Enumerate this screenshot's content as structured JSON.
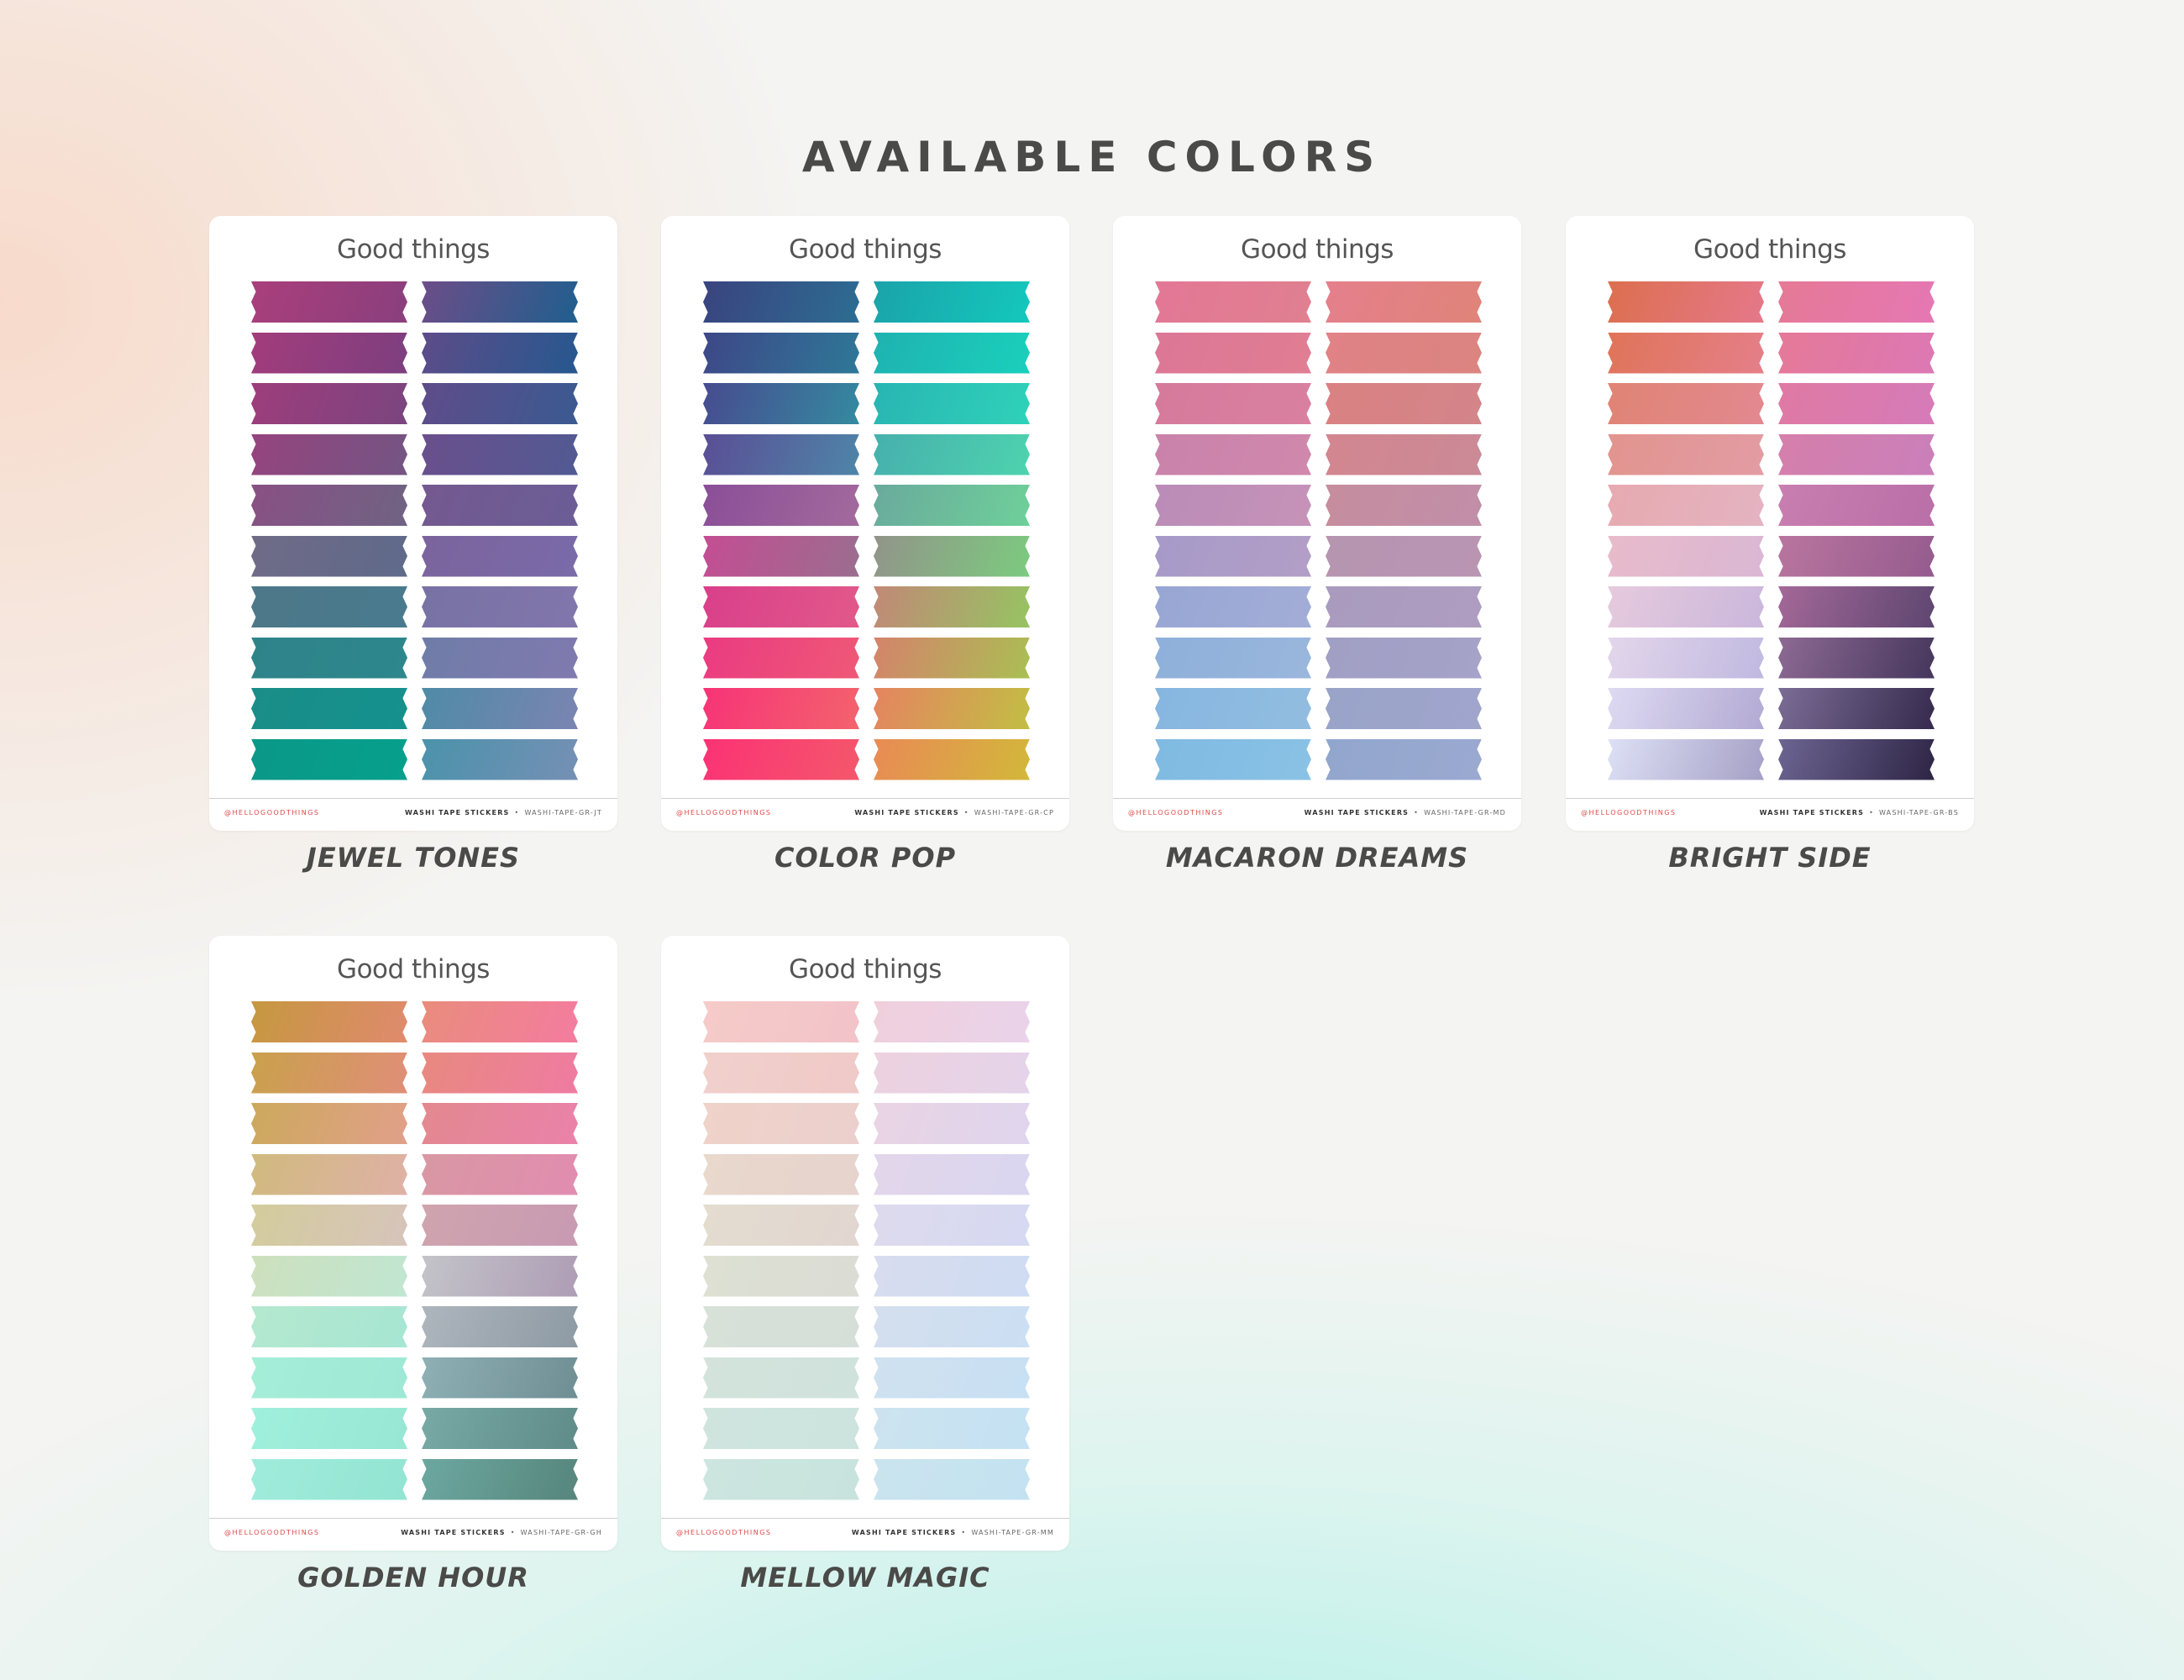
{
  "title": "AVAILABLE COLORS",
  "sheets": [
    {
      "brand": "Good things",
      "handle": "@HELLOGOODTHINGS",
      "product": "WASHI TAPE STICKERS",
      "sku": "WASHI-TAPE-GR-JT",
      "caption": "JEWEL TONES",
      "left": [
        [
          "#a93f7c",
          "#8a3f7d"
        ],
        [
          "#a33c7c",
          "#7c3f7f"
        ],
        [
          "#9e3d7c",
          "#7a457f"
        ],
        [
          "#96447f",
          "#735583"
        ],
        [
          "#895084",
          "#6f6383"
        ],
        [
          "#6f6b87",
          "#5f6a8a"
        ],
        [
          "#4c7889",
          "#4a7a8e"
        ],
        [
          "#2e8389",
          "#2d878c"
        ],
        [
          "#1a8d88",
          "#15918d"
        ],
        [
          "#0b9888",
          "#06a08d"
        ]
      ],
      "right": [
        [
          "#6c4d88",
          "#1f5f8e"
        ],
        [
          "#5d4c89",
          "#26588f"
        ],
        [
          "#5f4c8a",
          "#3a5a91"
        ],
        [
          "#6a4f8c",
          "#515a93"
        ],
        [
          "#745990",
          "#6b5d96"
        ],
        [
          "#7b649d",
          "#7a6aa9"
        ],
        [
          "#7872a4",
          "#8176ac"
        ],
        [
          "#6f7ca8",
          "#807aaf"
        ],
        [
          "#4f8ba6",
          "#7b84b2"
        ],
        [
          "#4b92aa",
          "#7590b5"
        ]
      ]
    },
    {
      "brand": "Good things",
      "handle": "@HELLOGOODTHINGS",
      "product": "WASHI TAPE STICKERS",
      "sku": "WASHI-TAPE-GR-CP",
      "caption": "COLOR POP",
      "left": [
        [
          "#3a437f",
          "#2c6d92"
        ],
        [
          "#3e4787",
          "#2e7898"
        ],
        [
          "#474b8f",
          "#348aa0"
        ],
        [
          "#5a4e95",
          "#4e85a8"
        ],
        [
          "#8a4e98",
          "#a26a9c"
        ],
        [
          "#c44d93",
          "#9a6e8f"
        ],
        [
          "#d93f8a",
          "#e2598a"
        ],
        [
          "#ea3b82",
          "#ef5876"
        ],
        [
          "#f73377",
          "#f3636d"
        ],
        [
          "#fb3275",
          "#f4576b"
        ]
      ],
      "right": [
        [
          "#1aa3a9",
          "#14c8bd"
        ],
        [
          "#1fb2b0",
          "#1ad0bc"
        ],
        [
          "#29b5b3",
          "#2fd2b9"
        ],
        [
          "#46b0ad",
          "#4ed3ae"
        ],
        [
          "#6aaa9c",
          "#6ed09a"
        ],
        [
          "#929489",
          "#7ccb7f"
        ],
        [
          "#c28876",
          "#96c462"
        ],
        [
          "#d4836b",
          "#aabf53"
        ],
        [
          "#e58460",
          "#c2be44"
        ],
        [
          "#e98a55",
          "#d2b83a"
        ]
      ]
    },
    {
      "brand": "Good things",
      "handle": "@HELLOGOODTHINGS",
      "product": "WASHI TAPE STICKERS",
      "sku": "WASHI-TAPE-GR-MD",
      "caption": "MACARON DREAMS",
      "left": [
        [
          "#e37796",
          "#e08090"
        ],
        [
          "#dc7796",
          "#e07e93"
        ],
        [
          "#d67a9c",
          "#d980a0"
        ],
        [
          "#c982aa",
          "#d088ad"
        ],
        [
          "#ba8cb7",
          "#c692b8"
        ],
        [
          "#a69ac9",
          "#b39ec6"
        ],
        [
          "#98a6d4",
          "#a3add7"
        ],
        [
          "#8eb0da",
          "#9ab6dc"
        ],
        [
          "#86b6e0",
          "#92bde0"
        ],
        [
          "#7fbae2",
          "#8ac2e5"
        ]
      ],
      "right": [
        [
          "#e57f8c",
          "#df8479"
        ],
        [
          "#e08286",
          "#db8480"
        ],
        [
          "#da8183",
          "#d38589"
        ],
        [
          "#d3868f",
          "#ca8a97"
        ],
        [
          "#c68d9e",
          "#c18ea9"
        ],
        [
          "#b695b1",
          "#b995b2"
        ],
        [
          "#a99bbe",
          "#ae9dc0"
        ],
        [
          "#a09fc4",
          "#a6a2c8"
        ],
        [
          "#99a3c8",
          "#a0a5cc"
        ],
        [
          "#92a6cd",
          "#9aa9d0"
        ]
      ]
    },
    {
      "brand": "Good things",
      "handle": "@HELLOGOODTHINGS",
      "product": "WASHI TAPE STICKERS",
      "sku": "WASHI-TAPE-GR-BS",
      "caption": "BRIGHT SIDE",
      "left": [
        [
          "#dc6f4e",
          "#e5788a"
        ],
        [
          "#df7458",
          "#e57f8a"
        ],
        [
          "#e08474",
          "#e38890"
        ],
        [
          "#e2948e",
          "#e39ca4"
        ],
        [
          "#e7aab0",
          "#e4b3c1"
        ],
        [
          "#e8bbca",
          "#dab7d4"
        ],
        [
          "#e6cadd",
          "#cab7dc"
        ],
        [
          "#e3d6eb",
          "#c0b9e0"
        ],
        [
          "#dedaf2",
          "#b2aad3"
        ],
        [
          "#dde0f5",
          "#a5a0c6"
        ]
      ],
      "right": [
        [
          "#e57995",
          "#e577b4"
        ],
        [
          "#e57998",
          "#dc78b4"
        ],
        [
          "#e079a3",
          "#d57bb9"
        ],
        [
          "#d57fab",
          "#ca7fba"
        ],
        [
          "#c97eb0",
          "#b96fa7"
        ],
        [
          "#b9759f",
          "#955b8e"
        ],
        [
          "#a46898",
          "#5d4670"
        ],
        [
          "#8d6a93",
          "#45365c"
        ],
        [
          "#7b6c94",
          "#352a4e"
        ],
        [
          "#6c6592",
          "#2e2545"
        ]
      ]
    },
    {
      "brand": "Good things",
      "handle": "@HELLOGOODTHINGS",
      "product": "WASHI TAPE STICKERS",
      "sku": "WASHI-TAPE-GR-GH",
      "caption": "GOLDEN HOUR",
      "left": [
        [
          "#c5983f",
          "#e08a6e"
        ],
        [
          "#c9a14b",
          "#e08e78"
        ],
        [
          "#cca95c",
          "#e1a08a"
        ],
        [
          "#d0ba7e",
          "#dfb1a6"
        ],
        [
          "#d3cc9c",
          "#d7c4bb"
        ],
        [
          "#cde0bd",
          "#c0e6d2"
        ],
        [
          "#b5e8cf",
          "#a6e6d3"
        ],
        [
          "#a5eed8",
          "#9ee8d5"
        ],
        [
          "#9ff0dc",
          "#98e6d4"
        ],
        [
          "#a0ecdc",
          "#93e4d2"
        ]
      ],
      "right": [
        [
          "#e98c7c",
          "#f47ca0"
        ],
        [
          "#e8897f",
          "#ef7ba2"
        ],
        [
          "#e3888f",
          "#ea82aa"
        ],
        [
          "#d898a3",
          "#e28cb0"
        ],
        [
          "#cfa4ad",
          "#c89ab3"
        ],
        [
          "#c3c4c9",
          "#ae9cb5"
        ],
        [
          "#aeb5bd",
          "#8d9aa4"
        ],
        [
          "#8fb0b4",
          "#6e8e93"
        ],
        [
          "#78aaa5",
          "#5f8b88"
        ],
        [
          "#6ca8a0",
          "#56857c"
        ]
      ]
    },
    {
      "brand": "Good things",
      "handle": "@HELLOGOODTHINGS",
      "product": "WASHI TAPE STICKERS",
      "sku": "WASHI-TAPE-GR-MM",
      "caption": "MELLOW MAGIC",
      "left": [
        [
          "#f5cbc8",
          "#f2c3c9"
        ],
        [
          "#f1d0cc",
          "#efc9c7"
        ],
        [
          "#efd3ca",
          "#eccfcc"
        ],
        [
          "#e9d8cc",
          "#e6d3cd"
        ],
        [
          "#e3dccf",
          "#e2d6d1"
        ],
        [
          "#dde0d3",
          "#dbdcd4"
        ],
        [
          "#d8e1d8",
          "#d5dfd8"
        ],
        [
          "#d3e3dc",
          "#d0e2dc"
        ],
        [
          "#d0e4de",
          "#cce3de"
        ],
        [
          "#cce5df",
          "#c8e3de"
        ]
      ],
      "right": [
        [
          "#f0cfdc",
          "#e9d3ea"
        ],
        [
          "#edd2df",
          "#e4d3ea"
        ],
        [
          "#e9d4e3",
          "#dfd5ee"
        ],
        [
          "#e3d6ea",
          "#d9d6f0"
        ],
        [
          "#dedaee",
          "#d5d9f1"
        ],
        [
          "#d8dcee",
          "#cedcf3"
        ],
        [
          "#d4dfee",
          "#cbdff3"
        ],
        [
          "#d0e1ef",
          "#c7e0f3"
        ],
        [
          "#cde3ef",
          "#c4e2f3"
        ],
        [
          "#cae4ee",
          "#c3e2f1"
        ]
      ]
    }
  ]
}
